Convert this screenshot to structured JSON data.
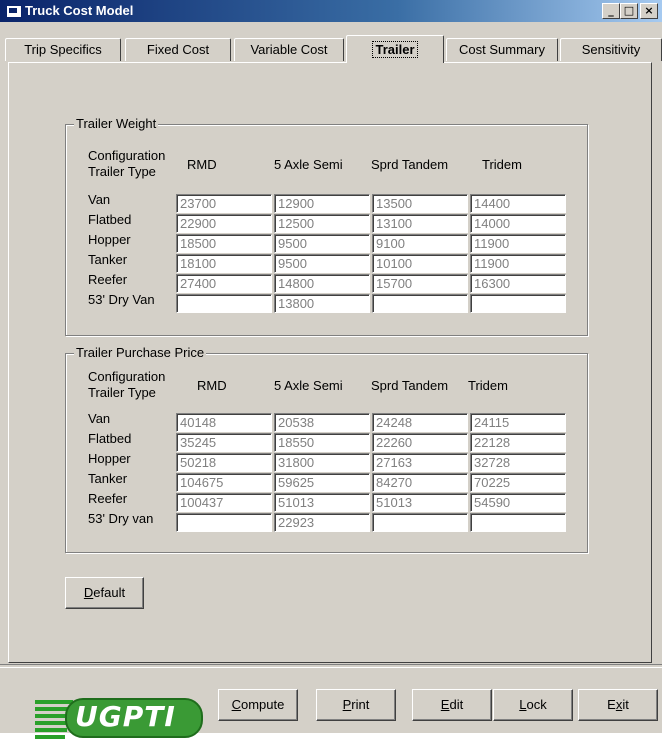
{
  "window": {
    "title": "Truck Cost Model"
  },
  "tabs": [
    {
      "label": "Trip Specifics"
    },
    {
      "label": "Fixed Cost"
    },
    {
      "label": "Variable Cost"
    },
    {
      "label": "Trailer",
      "active": true
    },
    {
      "label": "Cost Summary"
    },
    {
      "label": "Sensitivity"
    }
  ],
  "trailer_weight": {
    "title": "Trailer Weight",
    "header_line1": "Configuration",
    "header_line2": "Trailer Type",
    "columns": [
      "RMD",
      "5 Axle Semi",
      "Sprd Tandem",
      "Tridem"
    ],
    "rows": [
      {
        "label": "Van",
        "values": [
          "23700",
          "12900",
          "13500",
          "14400"
        ]
      },
      {
        "label": "Flatbed",
        "values": [
          "22900",
          "12500",
          "13100",
          "14000"
        ]
      },
      {
        "label": "Hopper",
        "values": [
          "18500",
          "9500",
          "9100",
          "11900"
        ]
      },
      {
        "label": "Tanker",
        "values": [
          "18100",
          "9500",
          "10100",
          "11900"
        ]
      },
      {
        "label": "Reefer",
        "values": [
          "27400",
          "14800",
          "15700",
          "16300"
        ]
      },
      {
        "label": "53' Dry Van",
        "values": [
          "",
          "13800",
          "",
          ""
        ]
      }
    ]
  },
  "trailer_price": {
    "title": "Trailer Purchase Price",
    "header_line1": "Configuration",
    "header_line2": "Trailer Type",
    "columns": [
      "RMD",
      "5 Axle Semi",
      "Sprd Tandem",
      "Tridem"
    ],
    "rows": [
      {
        "label": "Van",
        "values": [
          "40148",
          "20538",
          "24248",
          "24115"
        ]
      },
      {
        "label": "Flatbed",
        "values": [
          "35245",
          "18550",
          "22260",
          "22128"
        ]
      },
      {
        "label": "Hopper",
        "values": [
          "50218",
          "31800",
          "27163",
          "32728"
        ]
      },
      {
        "label": "Tanker",
        "values": [
          "104675",
          "59625",
          "84270",
          "70225"
        ]
      },
      {
        "label": "Reefer",
        "values": [
          "100437",
          "51013",
          "51013",
          "54590"
        ]
      },
      {
        "label": "53' Dry van",
        "values": [
          "",
          "22923",
          "",
          ""
        ]
      }
    ]
  },
  "buttons": {
    "default": {
      "label": "Default",
      "accel": "D",
      "rest": "efault"
    },
    "compute": {
      "label": "Compute",
      "accel": "C",
      "rest": "ompute"
    },
    "print": {
      "label": "Print",
      "accel": "P",
      "rest": "rint"
    },
    "edit": {
      "label": "Edit",
      "accel": "E",
      "rest": "dit"
    },
    "lock": {
      "label": "Lock",
      "accel": "L",
      "rest": "ock"
    },
    "exit": {
      "label": "Exit",
      "pre": "E",
      "accel": "x",
      "rest": "it"
    }
  },
  "logo": {
    "text": "UGPTI"
  },
  "colors": {
    "title_bar": "#0a246a",
    "face": "#d4d0c8",
    "logo_green": "#3a9a35"
  }
}
